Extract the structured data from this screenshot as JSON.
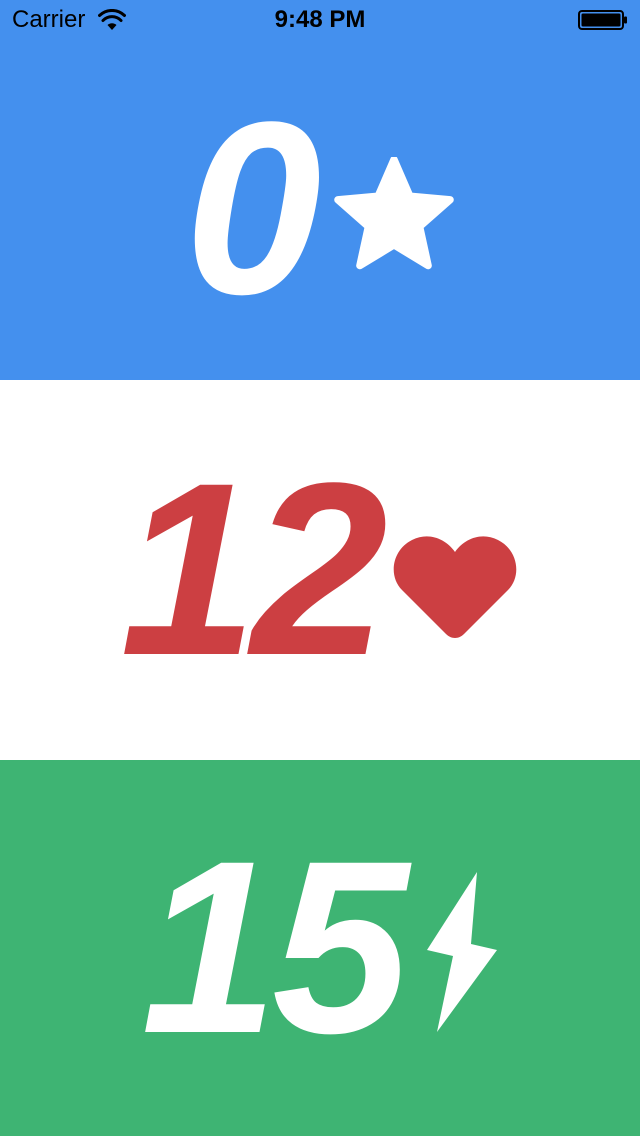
{
  "status_bar": {
    "carrier": "Carrier",
    "time": "9:48 PM",
    "wifi_icon": "wifi-icon",
    "battery_icon": "battery-icon"
  },
  "counters": [
    {
      "value": "0",
      "icon": "star-icon",
      "background": "#4490ee",
      "color": "#ffffff"
    },
    {
      "value": "12",
      "icon": "heart-icon",
      "background": "#ffffff",
      "color": "#cc3f42"
    },
    {
      "value": "15",
      "icon": "lightning-bolt-icon",
      "background": "#3eb473",
      "color": "#ffffff"
    }
  ]
}
